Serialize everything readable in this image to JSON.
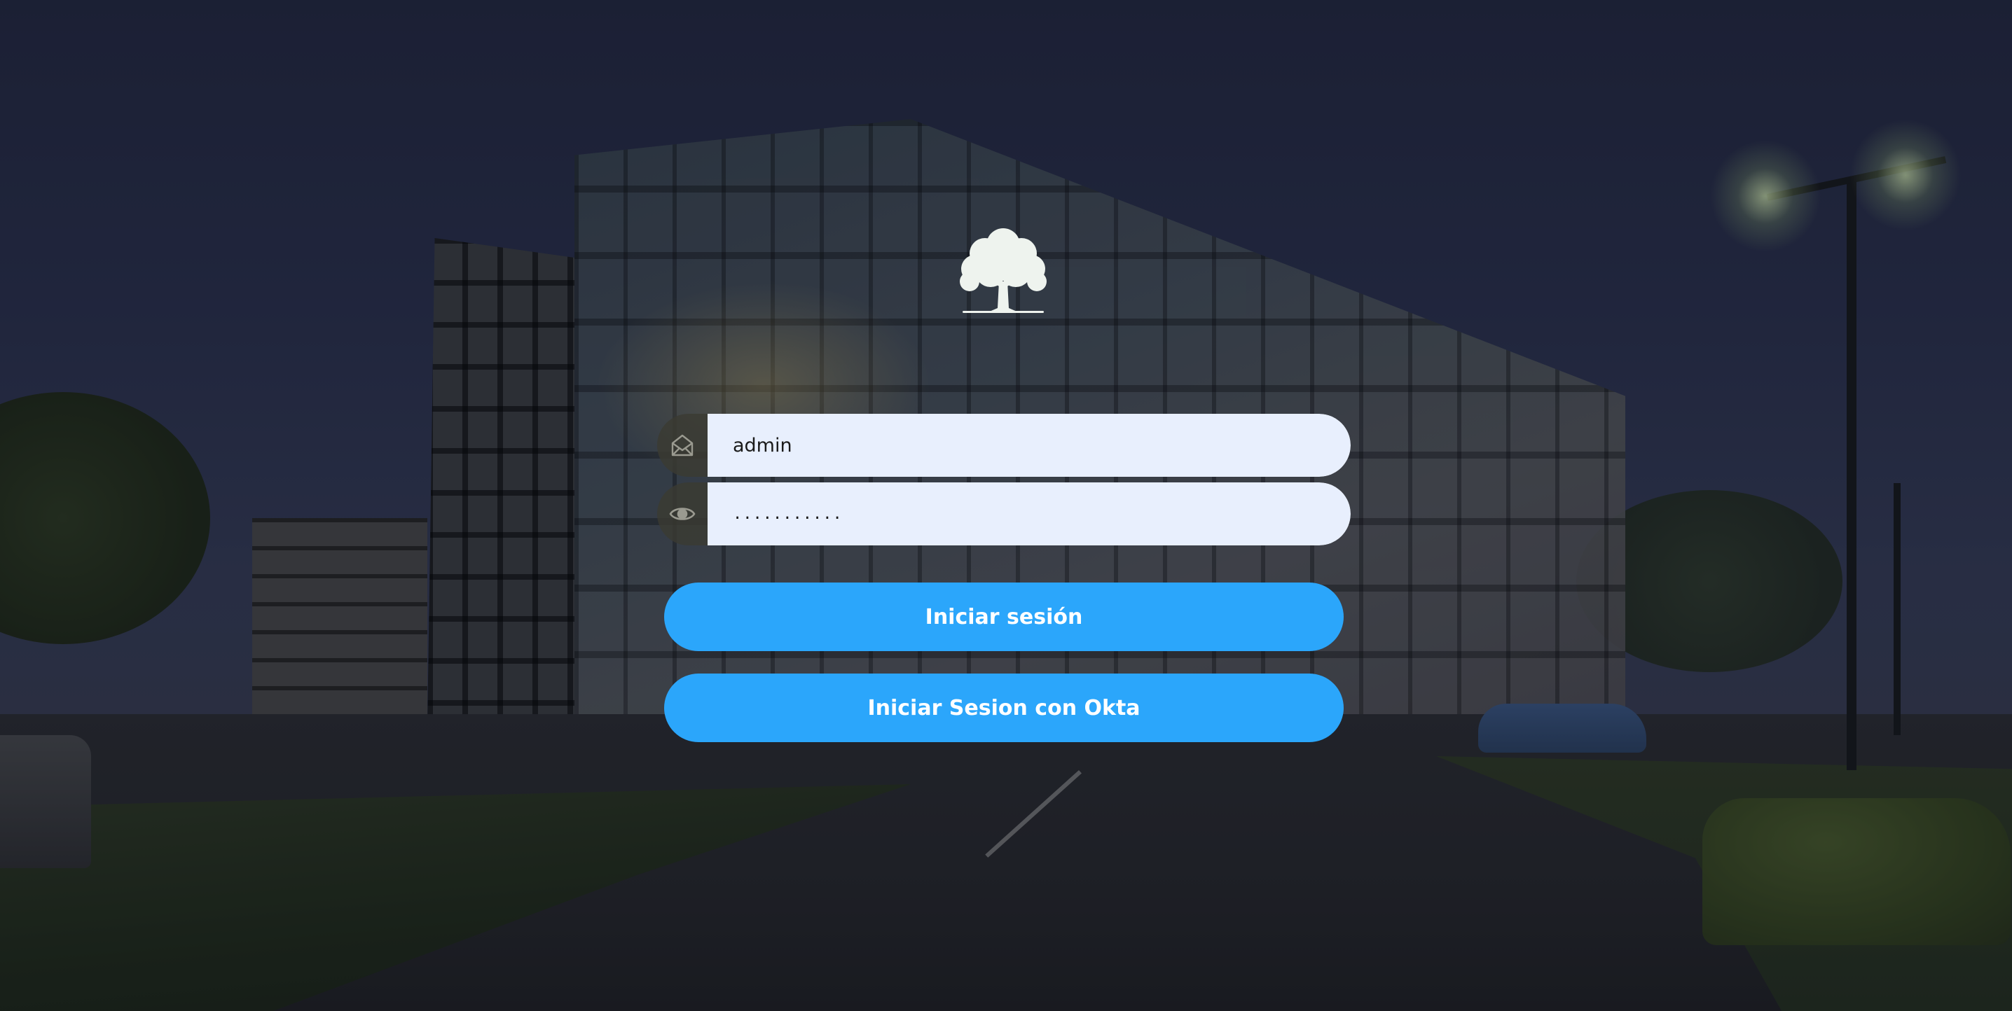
{
  "login": {
    "logo_icon": "tree-logo-icon",
    "email_icon": "envelope-open-icon",
    "password_icon": "eye-icon",
    "username_value": "admin",
    "password_value": "...........",
    "login_button_label": "Iniciar sesión",
    "okta_button_label": "Iniciar Sesion con Okta"
  },
  "colors": {
    "primary_button": "#2ba6fb",
    "input_background": "#e8effd",
    "icon_pill_background": "#3a3a32",
    "button_text": "#ffffff"
  }
}
